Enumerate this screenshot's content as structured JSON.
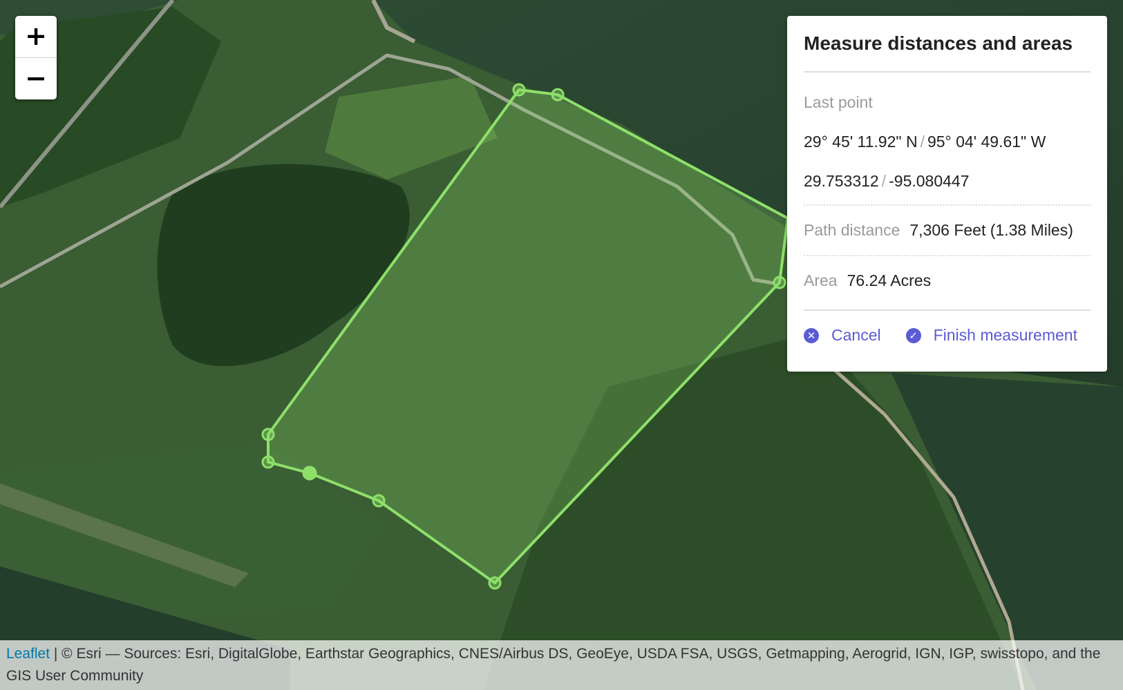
{
  "map": {
    "zoom_in_label": "+",
    "zoom_out_label": "−",
    "polygon_color": "#8ee06a",
    "panel": {
      "title": "Measure distances and areas",
      "last_point_label": "Last point",
      "last_point_dms_lat": "29° 45' 11.92\" N",
      "last_point_dms_lng": "95° 04' 49.61\" W",
      "last_point_dec_lat": "29.753312",
      "last_point_dec_lng": "-95.080447",
      "separator": "/",
      "path_distance_label": "Path distance",
      "path_distance_value": "7,306 Feet (1.38 Miles)",
      "area_label": "Area",
      "area_value": "76.24 Acres",
      "cancel_label": "Cancel",
      "cancel_icon": "close-circle-icon",
      "finish_label": "Finish measurement",
      "finish_icon": "check-circle-icon",
      "accent_color": "#5b5bd6"
    },
    "attribution": {
      "link_label": "Leaflet",
      "text": " | © Esri — Sources: Esri, DigitalGlobe, Earthstar Geographics, CNES/Airbus DS, GeoEye, USDA FSA, USGS, Getmapping, Aerogrid, IGN, IGP, swisstopo, and the GIS User Community"
    }
  }
}
